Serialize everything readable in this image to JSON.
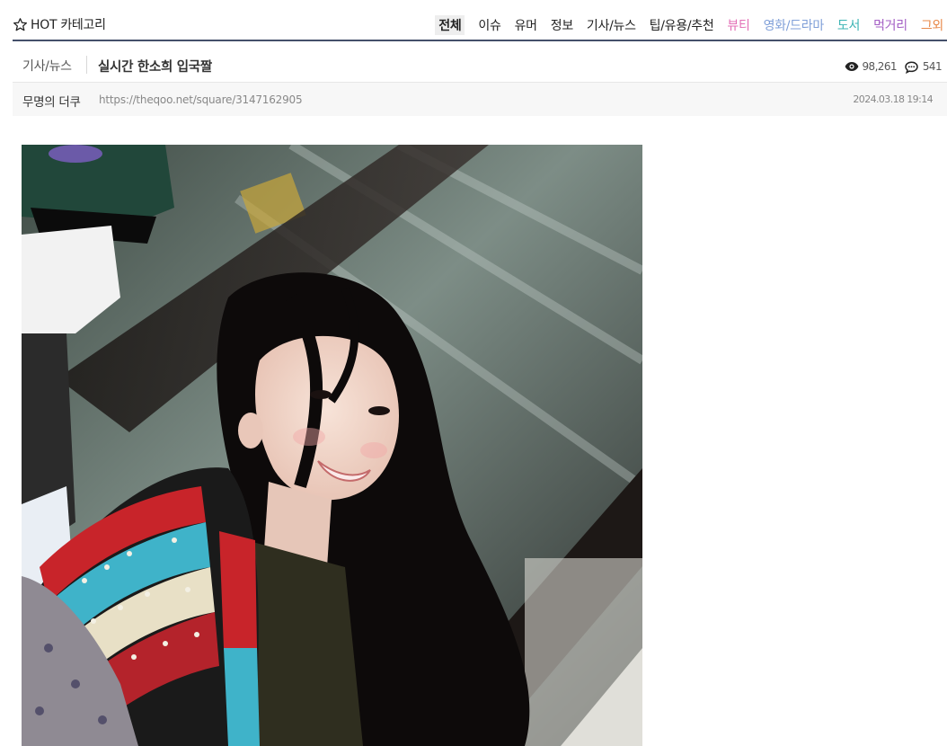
{
  "category_bar": {
    "title": "HOT 카테고리",
    "tabs": [
      {
        "label": "전체",
        "color": "#222222",
        "active": true
      },
      {
        "label": "이슈",
        "color": "#222222",
        "active": false
      },
      {
        "label": "유머",
        "color": "#222222",
        "active": false
      },
      {
        "label": "정보",
        "color": "#222222",
        "active": false
      },
      {
        "label": "기사/뉴스",
        "color": "#222222",
        "active": false
      },
      {
        "label": "팁/유용/추천",
        "color": "#222222",
        "active": false
      },
      {
        "label": "뷰티",
        "color": "#e36fb6",
        "active": false
      },
      {
        "label": "영화/드라마",
        "color": "#7f9fd8",
        "active": false
      },
      {
        "label": "도서",
        "color": "#3bb3b3",
        "active": false
      },
      {
        "label": "먹거리",
        "color": "#a35ec4",
        "active": false
      },
      {
        "label": "그외",
        "color": "#e8894a",
        "active": false
      }
    ],
    "accent_color": "#44506a"
  },
  "post": {
    "board": "기사/뉴스",
    "title": "실시간 한소희 입국짤",
    "views": "98,261",
    "comments": "541",
    "author": "무명의 더쿠",
    "url": "https://theqoo.net/square/3147162905",
    "date": "2024.03.18 19:14"
  },
  "icons": {
    "star": "star-outline-icon",
    "views": "eye-icon",
    "comments": "speech-bubble-icon"
  }
}
